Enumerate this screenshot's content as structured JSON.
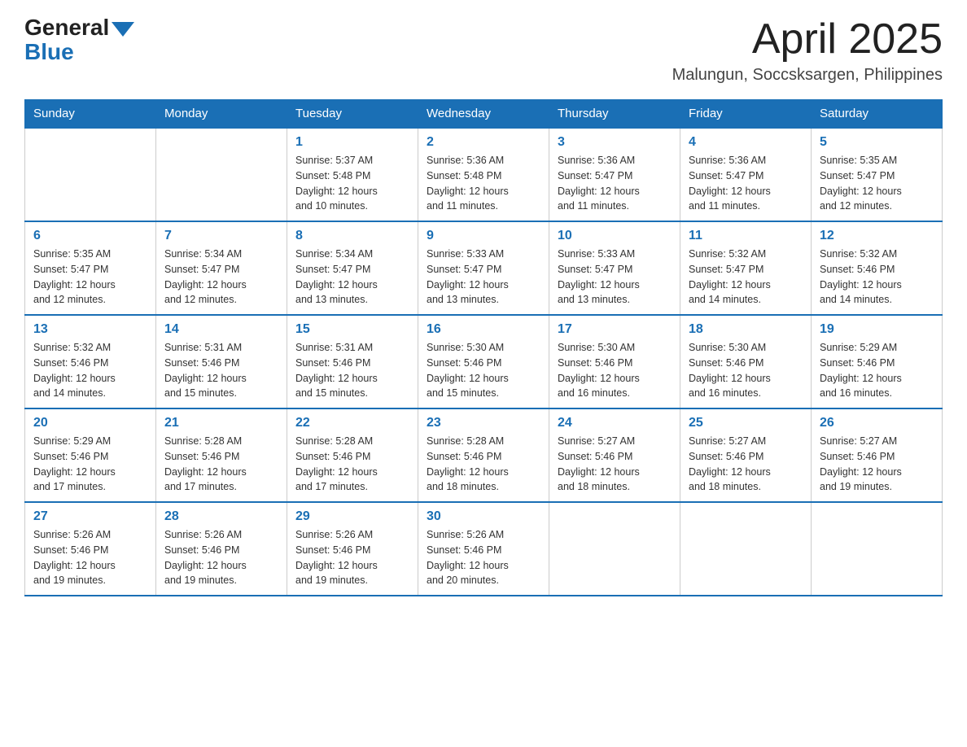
{
  "header": {
    "logo_general": "General",
    "logo_blue": "Blue",
    "month_title": "April 2025",
    "location": "Malungun, Soccsksargen, Philippines"
  },
  "calendar": {
    "days_of_week": [
      "Sunday",
      "Monday",
      "Tuesday",
      "Wednesday",
      "Thursday",
      "Friday",
      "Saturday"
    ],
    "weeks": [
      [
        {
          "day": "",
          "info": ""
        },
        {
          "day": "",
          "info": ""
        },
        {
          "day": "1",
          "info": "Sunrise: 5:37 AM\nSunset: 5:48 PM\nDaylight: 12 hours\nand 10 minutes."
        },
        {
          "day": "2",
          "info": "Sunrise: 5:36 AM\nSunset: 5:48 PM\nDaylight: 12 hours\nand 11 minutes."
        },
        {
          "day": "3",
          "info": "Sunrise: 5:36 AM\nSunset: 5:47 PM\nDaylight: 12 hours\nand 11 minutes."
        },
        {
          "day": "4",
          "info": "Sunrise: 5:36 AM\nSunset: 5:47 PM\nDaylight: 12 hours\nand 11 minutes."
        },
        {
          "day": "5",
          "info": "Sunrise: 5:35 AM\nSunset: 5:47 PM\nDaylight: 12 hours\nand 12 minutes."
        }
      ],
      [
        {
          "day": "6",
          "info": "Sunrise: 5:35 AM\nSunset: 5:47 PM\nDaylight: 12 hours\nand 12 minutes."
        },
        {
          "day": "7",
          "info": "Sunrise: 5:34 AM\nSunset: 5:47 PM\nDaylight: 12 hours\nand 12 minutes."
        },
        {
          "day": "8",
          "info": "Sunrise: 5:34 AM\nSunset: 5:47 PM\nDaylight: 12 hours\nand 13 minutes."
        },
        {
          "day": "9",
          "info": "Sunrise: 5:33 AM\nSunset: 5:47 PM\nDaylight: 12 hours\nand 13 minutes."
        },
        {
          "day": "10",
          "info": "Sunrise: 5:33 AM\nSunset: 5:47 PM\nDaylight: 12 hours\nand 13 minutes."
        },
        {
          "day": "11",
          "info": "Sunrise: 5:32 AM\nSunset: 5:47 PM\nDaylight: 12 hours\nand 14 minutes."
        },
        {
          "day": "12",
          "info": "Sunrise: 5:32 AM\nSunset: 5:46 PM\nDaylight: 12 hours\nand 14 minutes."
        }
      ],
      [
        {
          "day": "13",
          "info": "Sunrise: 5:32 AM\nSunset: 5:46 PM\nDaylight: 12 hours\nand 14 minutes."
        },
        {
          "day": "14",
          "info": "Sunrise: 5:31 AM\nSunset: 5:46 PM\nDaylight: 12 hours\nand 15 minutes."
        },
        {
          "day": "15",
          "info": "Sunrise: 5:31 AM\nSunset: 5:46 PM\nDaylight: 12 hours\nand 15 minutes."
        },
        {
          "day": "16",
          "info": "Sunrise: 5:30 AM\nSunset: 5:46 PM\nDaylight: 12 hours\nand 15 minutes."
        },
        {
          "day": "17",
          "info": "Sunrise: 5:30 AM\nSunset: 5:46 PM\nDaylight: 12 hours\nand 16 minutes."
        },
        {
          "day": "18",
          "info": "Sunrise: 5:30 AM\nSunset: 5:46 PM\nDaylight: 12 hours\nand 16 minutes."
        },
        {
          "day": "19",
          "info": "Sunrise: 5:29 AM\nSunset: 5:46 PM\nDaylight: 12 hours\nand 16 minutes."
        }
      ],
      [
        {
          "day": "20",
          "info": "Sunrise: 5:29 AM\nSunset: 5:46 PM\nDaylight: 12 hours\nand 17 minutes."
        },
        {
          "day": "21",
          "info": "Sunrise: 5:28 AM\nSunset: 5:46 PM\nDaylight: 12 hours\nand 17 minutes."
        },
        {
          "day": "22",
          "info": "Sunrise: 5:28 AM\nSunset: 5:46 PM\nDaylight: 12 hours\nand 17 minutes."
        },
        {
          "day": "23",
          "info": "Sunrise: 5:28 AM\nSunset: 5:46 PM\nDaylight: 12 hours\nand 18 minutes."
        },
        {
          "day": "24",
          "info": "Sunrise: 5:27 AM\nSunset: 5:46 PM\nDaylight: 12 hours\nand 18 minutes."
        },
        {
          "day": "25",
          "info": "Sunrise: 5:27 AM\nSunset: 5:46 PM\nDaylight: 12 hours\nand 18 minutes."
        },
        {
          "day": "26",
          "info": "Sunrise: 5:27 AM\nSunset: 5:46 PM\nDaylight: 12 hours\nand 19 minutes."
        }
      ],
      [
        {
          "day": "27",
          "info": "Sunrise: 5:26 AM\nSunset: 5:46 PM\nDaylight: 12 hours\nand 19 minutes."
        },
        {
          "day": "28",
          "info": "Sunrise: 5:26 AM\nSunset: 5:46 PM\nDaylight: 12 hours\nand 19 minutes."
        },
        {
          "day": "29",
          "info": "Sunrise: 5:26 AM\nSunset: 5:46 PM\nDaylight: 12 hours\nand 19 minutes."
        },
        {
          "day": "30",
          "info": "Sunrise: 5:26 AM\nSunset: 5:46 PM\nDaylight: 12 hours\nand 20 minutes."
        },
        {
          "day": "",
          "info": ""
        },
        {
          "day": "",
          "info": ""
        },
        {
          "day": "",
          "info": ""
        }
      ]
    ]
  }
}
